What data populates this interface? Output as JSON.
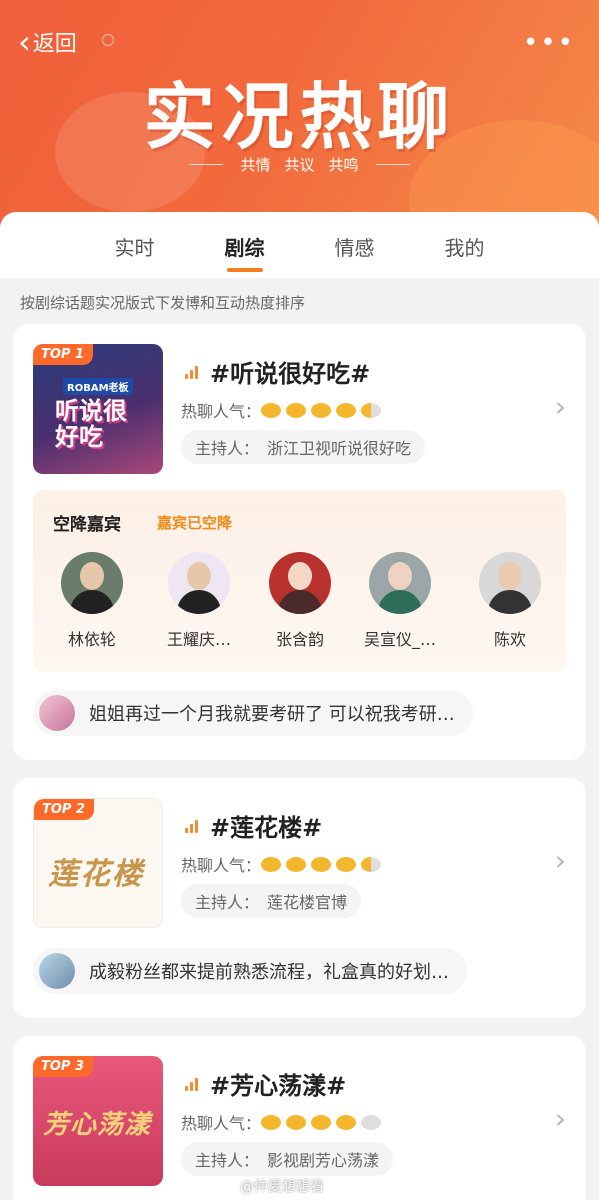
{
  "header": {
    "back_label": "返回",
    "more_label": "•••",
    "title": "实况热聊",
    "subtitle_words": [
      "共情",
      "共议",
      "共鸣"
    ]
  },
  "tabs": [
    {
      "label": "实时",
      "active": false
    },
    {
      "label": "剧综",
      "active": true
    },
    {
      "label": "情感",
      "active": false
    },
    {
      "label": "我的",
      "active": false
    }
  ],
  "subtitle": "按剧综话题实况版式下发博和互动热度排序",
  "heat_label": "热聊人气：",
  "host_label": "主持人：",
  "cards": [
    {
      "rank": "TOP 1",
      "topic": "#听说很好吃#",
      "heat": 4.5,
      "host": "浙江卫视听说很好吃",
      "cover_text": "听说很好吃",
      "cover_brand": "ROBAM老板",
      "guest_section": {
        "title": "空降嘉宾",
        "status": "嘉宾已空降",
        "guests": [
          "林依轮",
          "王耀庆…",
          "张含韵",
          "吴宣仪_…",
          "陈欢"
        ]
      },
      "comment": "姐姐再过一个月我就要考研了 可以祝我考研…"
    },
    {
      "rank": "TOP 2",
      "topic": "#莲花楼#",
      "heat": 4.5,
      "host": "莲花楼官博",
      "cover_text": "莲花楼",
      "comment": "成毅粉丝都来提前熟悉流程，礼盒真的好划…"
    },
    {
      "rank": "TOP 3",
      "topic": "#芳心荡漾#",
      "heat": 4,
      "host": "影视剧芳心荡漾",
      "cover_text": "芳心荡漾"
    }
  ],
  "watermark": "@仲夏想想看",
  "colors": {
    "header": "#f26a3c",
    "accent": "#f57c1f",
    "badge": "#ff6a2b",
    "heat_on": "#f4b62c"
  }
}
